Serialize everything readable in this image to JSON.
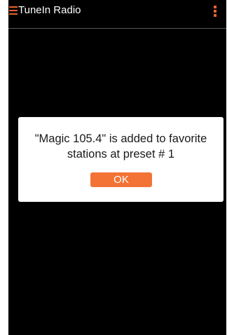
{
  "app_bar": {
    "title": "TuneIn Radio",
    "menu_icon": "hamburger-menu-icon",
    "overflow_icon": "overflow-menu-icon",
    "accent_color": "#e8622c"
  },
  "dialog": {
    "message": "\"Magic 105.4\" is added to favorite stations at preset # 1",
    "ok_label": "OK",
    "button_color": "#f37335"
  }
}
